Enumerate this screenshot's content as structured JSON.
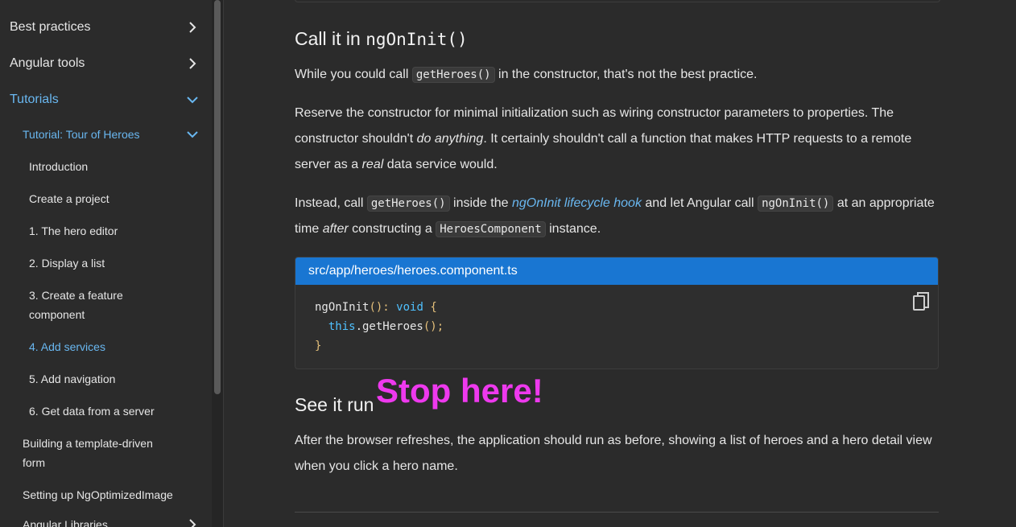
{
  "sidebar": {
    "best_practices": "Best practices",
    "angular_tools": "Angular tools",
    "tutorials": "Tutorials",
    "tour_of_heroes": "Tutorial: Tour of Heroes",
    "items": [
      "Introduction",
      "Create a project",
      "1. The hero editor",
      "2. Display a list",
      "3. Create a feature component",
      "4. Add services",
      "5. Add navigation",
      "6. Get data from a server"
    ],
    "template_driven": "Building a template-driven form",
    "ngoptimized": "Setting up NgOptimizedImage",
    "angular_libraries": "Angular Libraries"
  },
  "content": {
    "heading1_text": "Call it in",
    "heading1_code": "ngOnInit()",
    "p1_a": "While you could call",
    "p1_code": "getHeroes()",
    "p1_b": "in the constructor, that's not the best practice.",
    "p2_a": "Reserve the constructor for minimal initialization such as wiring constructor parameters to properties. The constructor shouldn't",
    "p2_em1": "do anything",
    "p2_b": ". It certainly shouldn't call a function that makes HTTP requests to a remote server as a",
    "p2_em2": "real",
    "p2_c": "data service would.",
    "p3_a": "Instead, call",
    "p3_code1": "getHeroes()",
    "p3_b": "inside the",
    "p3_link": "ngOnInit lifecycle hook",
    "p3_c": "and let Angular call",
    "p3_code2": "ngOnInit()",
    "p3_d": "at an appropriate time",
    "p3_em": "after",
    "p3_e": "constructing a",
    "p3_code3": "HeroesComponent",
    "p3_f": "instance.",
    "code_header": "src/app/heroes/heroes.component.ts",
    "code_l1_fn": "ngOnInit",
    "code_l1_paren": "()",
    "code_l1_colon": ": ",
    "code_l1_type": "void",
    "code_l1_brace": "{",
    "code_l2_this": "this",
    "code_l2_call": ".getHeroes",
    "code_l2_paren": "()",
    "code_l2_semi": ";",
    "code_l3_brace": "}",
    "heading2": "See it run",
    "overlay": "Stop here!",
    "p4": "After the browser refreshes, the application should run as before, showing a list of heroes and a hero detail view when you click a hero name."
  },
  "colors": {
    "accent": "#69b7f0",
    "header_blue": "#1976d2",
    "overlay": "#ee39ee"
  }
}
